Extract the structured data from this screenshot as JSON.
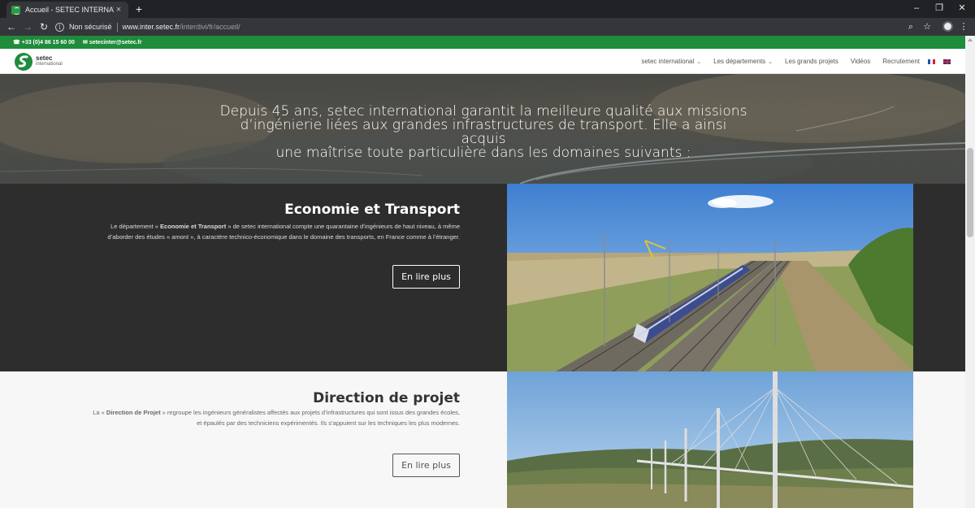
{
  "browser": {
    "tab_title": "Accueil - SETEC INTERNATIONAL",
    "tab_close": "×",
    "new_tab": "+",
    "url_security": "Non sécurisé",
    "url_host": "www.inter.setec.fr",
    "url_path": "/interdivi/fr/accueil/",
    "win_min": "–",
    "win_restore": "❐",
    "win_close": "✕"
  },
  "topbar": {
    "phone": "+33 (0)4 86 15 60 00",
    "email": "setecinter@setec.fr"
  },
  "logo": {
    "brand": "setec",
    "sub": "international"
  },
  "nav": {
    "items": [
      {
        "label": "setec international",
        "dropdown": true
      },
      {
        "label": "Les départements",
        "dropdown": true
      },
      {
        "label": "Les grands projets",
        "dropdown": false
      },
      {
        "label": "Vidéos",
        "dropdown": false
      },
      {
        "label": "Recrutement",
        "dropdown": false
      }
    ],
    "languages": [
      "fr",
      "en"
    ]
  },
  "hero": {
    "line1": "Depuis 45 ans, setec international garantit la meilleure qualité aux missions",
    "line2": "d’ingénierie liées aux grandes infrastructures de transport. Elle a ainsi acquis",
    "line3": "une maîtrise toute particulière dans les domaines suivants :"
  },
  "sections": [
    {
      "title": "Economie et Transport",
      "body_prefix": "Le département « ",
      "body_bold": "Economie et Transport",
      "body_line1_rest": " » de setec international compte une quarantaine d’ingénieurs de haut niveau, à même",
      "body_line2": "d’aborder des études « amont », à caractère technico-économique dans le domaine des transports, en France comme à l’étranger.",
      "button": "En lire plus"
    },
    {
      "title": "Direction de projet",
      "body_prefix": "La « ",
      "body_bold": "Direction de Projet",
      "body_line1_rest": " » regroupe les ingénieurs généralistes affectés aux projets d’infrastructures qui sont issus des grandes écoles,",
      "body_line2": "et épaulés par des techniciens expérimentés. Ils s’appuient sur les techniques les plus modernes.",
      "button": "En lire plus"
    }
  ],
  "colors": {
    "green": "#1e8c3a",
    "dark_section": "#2d2d2d",
    "light_section": "#f7f7f7"
  }
}
